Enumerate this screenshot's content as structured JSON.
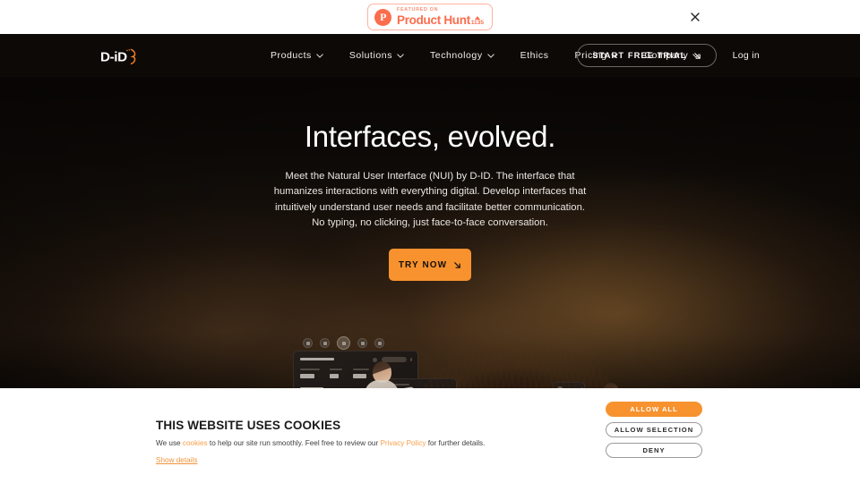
{
  "promo": {
    "badge_featured": "FEATURED ON",
    "badge_name": "Product Hunt",
    "badge_count": "1135",
    "badge_logo_letter": "P",
    "close_icon": "close-icon"
  },
  "nav": {
    "logo_text": "D-iD",
    "links": [
      {
        "label": "Products",
        "has_dropdown": true
      },
      {
        "label": "Solutions",
        "has_dropdown": true
      },
      {
        "label": "Technology",
        "has_dropdown": true
      },
      {
        "label": "Ethics",
        "has_dropdown": false
      },
      {
        "label": "Pricing",
        "has_dropdown": true
      },
      {
        "label": "Company",
        "has_dropdown": true
      }
    ],
    "trial_label": "START FREE TRIAL",
    "login_label": "Log in"
  },
  "hero": {
    "title": "Interfaces, evolved.",
    "subtitle": "Meet the Natural User Interface (NUI) by D-ID. The interface that humanizes interactions with everything digital. Develop interfaces that intuitively understand user needs and facilitate  better communication. No typing, no clicking, just face-to-face conversation.",
    "cta_label": "TRY NOW"
  },
  "cookie": {
    "title": "THIS WEBSITE USES COOKIES",
    "desc_part1": "We use ",
    "link_cookies": "cookies",
    "desc_part2": " to help our site run smoothly. Feel free to review our ",
    "link_privacy": "Privacy Policy",
    "desc_part3": " for further details.",
    "show_details": "Show details",
    "btn_allow_all": "ALLOW ALL",
    "btn_allow_selection": "ALLOW SELECTION",
    "btn_deny": "DENY"
  },
  "colors": {
    "accent_orange": "#f7922f",
    "nav_background": "#0d0906",
    "product_hunt": "#fb6d4c"
  }
}
